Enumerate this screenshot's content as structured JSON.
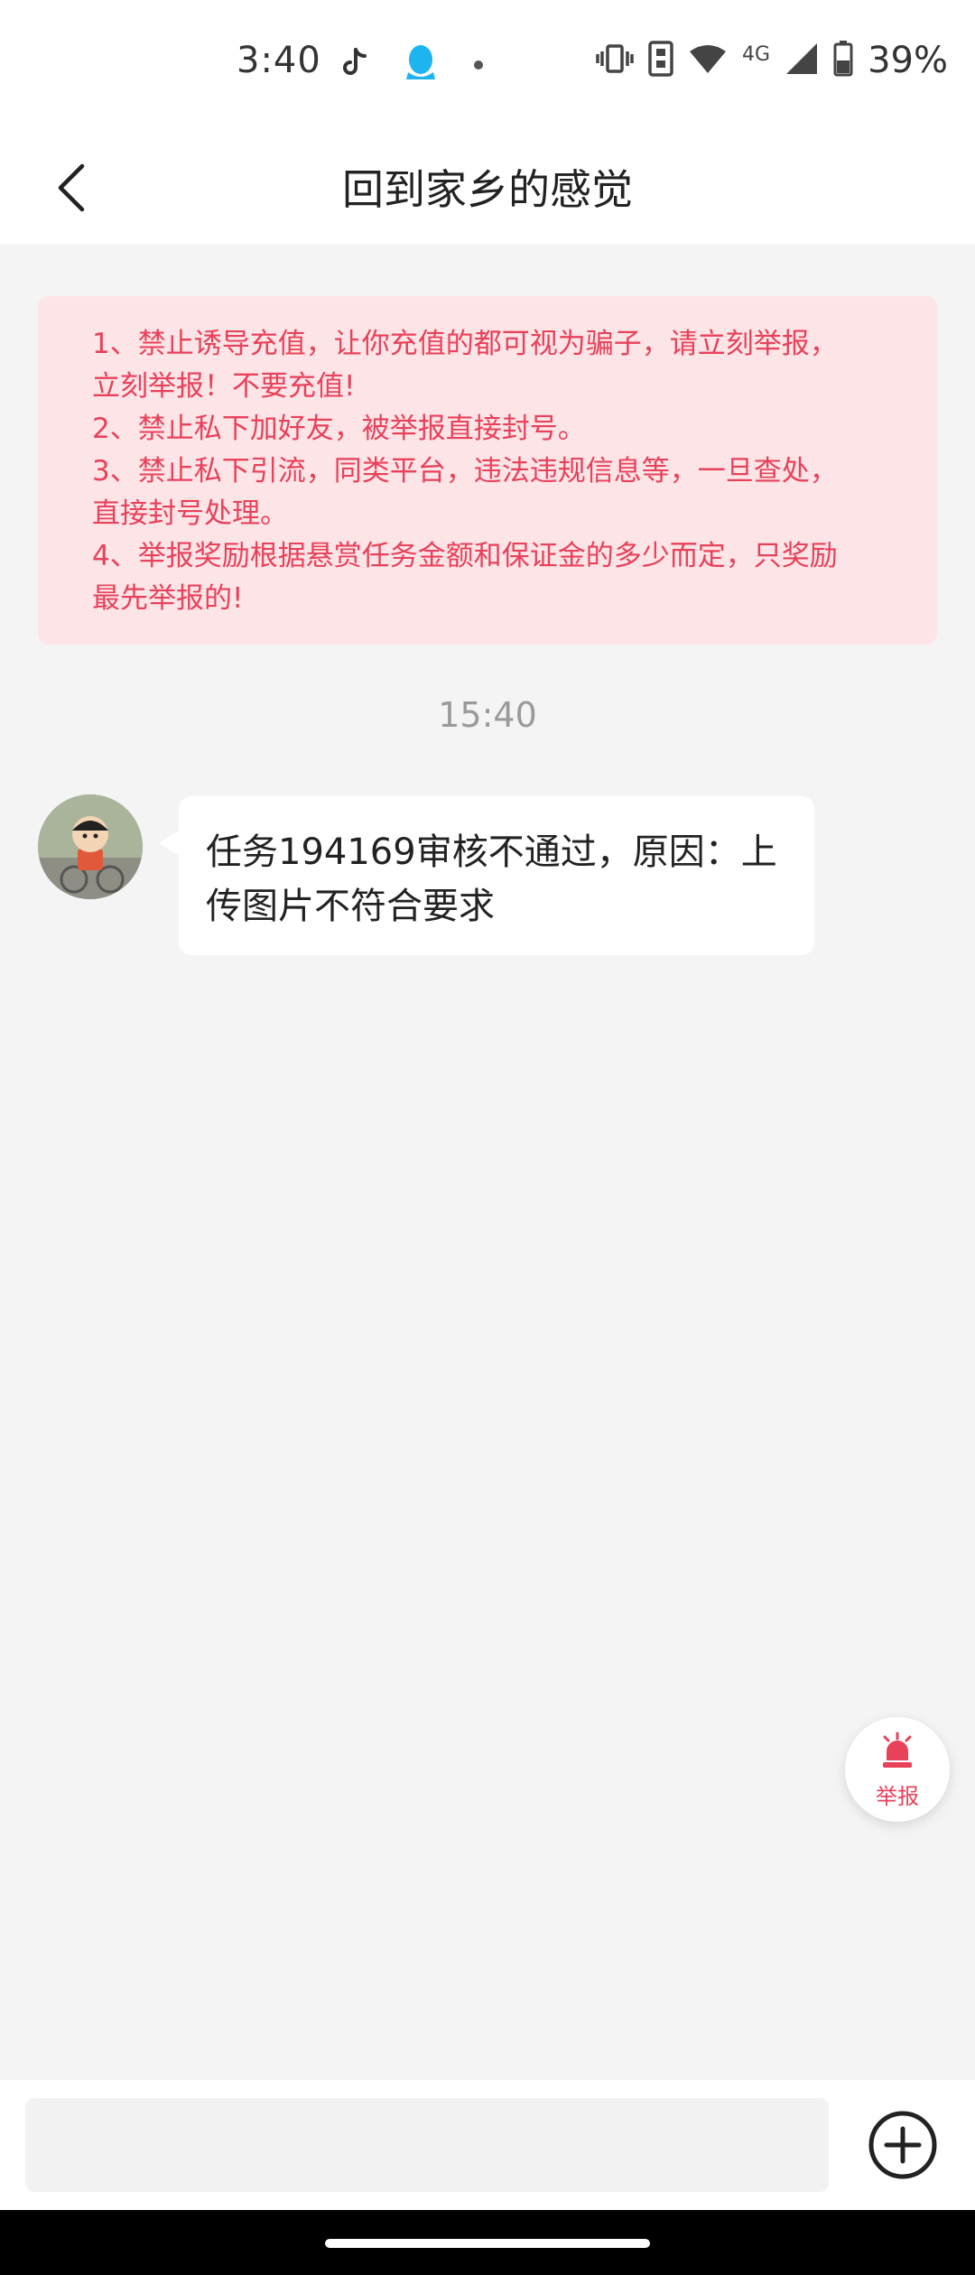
{
  "status_bar": {
    "time": "3:40",
    "network": "4G",
    "battery": "39%",
    "icons": [
      "tiktok-icon",
      "qq-icon",
      "dot-icon",
      "vibrate-icon",
      "sim-icon",
      "wifi-icon",
      "signal-icon",
      "battery-icon"
    ]
  },
  "header": {
    "title": "回到家乡的感觉",
    "back_icon": "chevron-left-icon"
  },
  "notice": {
    "lines": [
      "1、禁止诱导充值，让你充值的都可视为骗子，请立刻举报，",
      "立刻举报！不要充值!",
      "2、禁止私下加好友，被举报直接封号。",
      "3、禁止私下引流，同类平台，违法违规信息等，一旦查处，",
      "直接封号处理。",
      "4、举报奖励根据悬赏任务金额和保证金的多少而定，只奖励",
      "最先举报的!"
    ]
  },
  "chat": {
    "timestamp": "15:40",
    "messages": [
      {
        "line1": "任务194169审核不通过，原因：上",
        "line2": "传图片不符合要求"
      }
    ]
  },
  "report_button": {
    "label": "举报",
    "icon": "alarm-icon"
  },
  "composer": {
    "placeholder": "",
    "add_icon": "plus-circle-icon"
  },
  "colors": {
    "accent": "#e8415a",
    "notice_bg": "#fde4e6",
    "page_bg": "#f4f4f4"
  }
}
